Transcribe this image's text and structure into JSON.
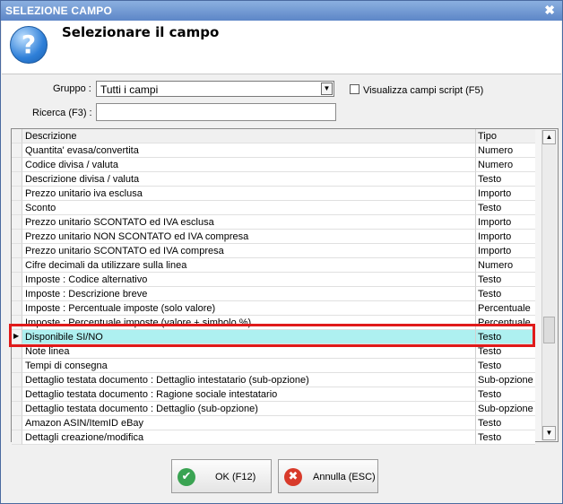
{
  "window": {
    "title": "SELEZIONE CAMPO",
    "close_glyph": "✖"
  },
  "header": {
    "icon": "question-icon",
    "icon_glyph": "?",
    "title": "Selezionare il campo"
  },
  "filters": {
    "gruppo_label": "Gruppo :",
    "gruppo_value": "Tutti i campi",
    "dropdown_glyph": "▼",
    "script_checkbox_label": "Visualizza campi script (F5)",
    "script_checkbox_checked": false,
    "ricerca_label": "Ricerca (F3) :",
    "ricerca_value": ""
  },
  "table": {
    "columns": [
      "Descrizione",
      "Tipo"
    ],
    "rows": [
      {
        "desc": "Quantita' evasa/convertita",
        "tipo": "Numero"
      },
      {
        "desc": "Codice divisa / valuta",
        "tipo": "Numero"
      },
      {
        "desc": "Descrizione divisa / valuta",
        "tipo": "Testo"
      },
      {
        "desc": "Prezzo unitario iva esclusa",
        "tipo": "Importo"
      },
      {
        "desc": "Sconto",
        "tipo": "Testo"
      },
      {
        "desc": "Prezzo unitario SCONTATO ed IVA esclusa",
        "tipo": "Importo"
      },
      {
        "desc": "Prezzo unitario NON SCONTATO ed IVA compresa",
        "tipo": "Importo"
      },
      {
        "desc": "Prezzo unitario SCONTATO ed IVA compresa",
        "tipo": "Importo"
      },
      {
        "desc": "Cifre decimali da utilizzare sulla linea",
        "tipo": "Numero"
      },
      {
        "desc": "Imposte : Codice alternativo",
        "tipo": "Testo"
      },
      {
        "desc": "Imposte : Descrizione breve",
        "tipo": "Testo"
      },
      {
        "desc": "Imposte : Percentuale imposte (solo valore)",
        "tipo": "Percentuale"
      },
      {
        "desc": "Imposte : Percentuale imposte (valore + simbolo %)",
        "tipo": "Percentuale"
      },
      {
        "desc": "Disponibile SI/NO",
        "tipo": "Testo",
        "selected": true
      },
      {
        "desc": "Note linea",
        "tipo": "Testo"
      },
      {
        "desc": "Tempi di consegna",
        "tipo": "Testo"
      },
      {
        "desc": "Dettaglio testata documento : Dettaglio intestatario (sub-opzione)",
        "tipo": "Sub-opzione"
      },
      {
        "desc": "Dettaglio testata documento : Ragione sociale intestatario",
        "tipo": "Testo"
      },
      {
        "desc": "Dettaglio testata documento : Dettaglio (sub-opzione)",
        "tipo": "Sub-opzione"
      },
      {
        "desc": "Amazon ASIN/ItemID eBay",
        "tipo": "Testo"
      },
      {
        "desc": "Dettagli creazione/modifica",
        "tipo": "Testo"
      }
    ]
  },
  "scrollbar": {
    "up_glyph": "▲",
    "down_glyph": "▼"
  },
  "buttons": {
    "ok": {
      "label": "OK (F12)",
      "icon": "check-icon",
      "glyph": "✔",
      "color": "#3aa352"
    },
    "cancel": {
      "label": "Annulla (ESC)",
      "icon": "cancel-icon",
      "glyph": "✖",
      "color": "#d83a2a"
    }
  },
  "highlight_color": "#e01a1a"
}
